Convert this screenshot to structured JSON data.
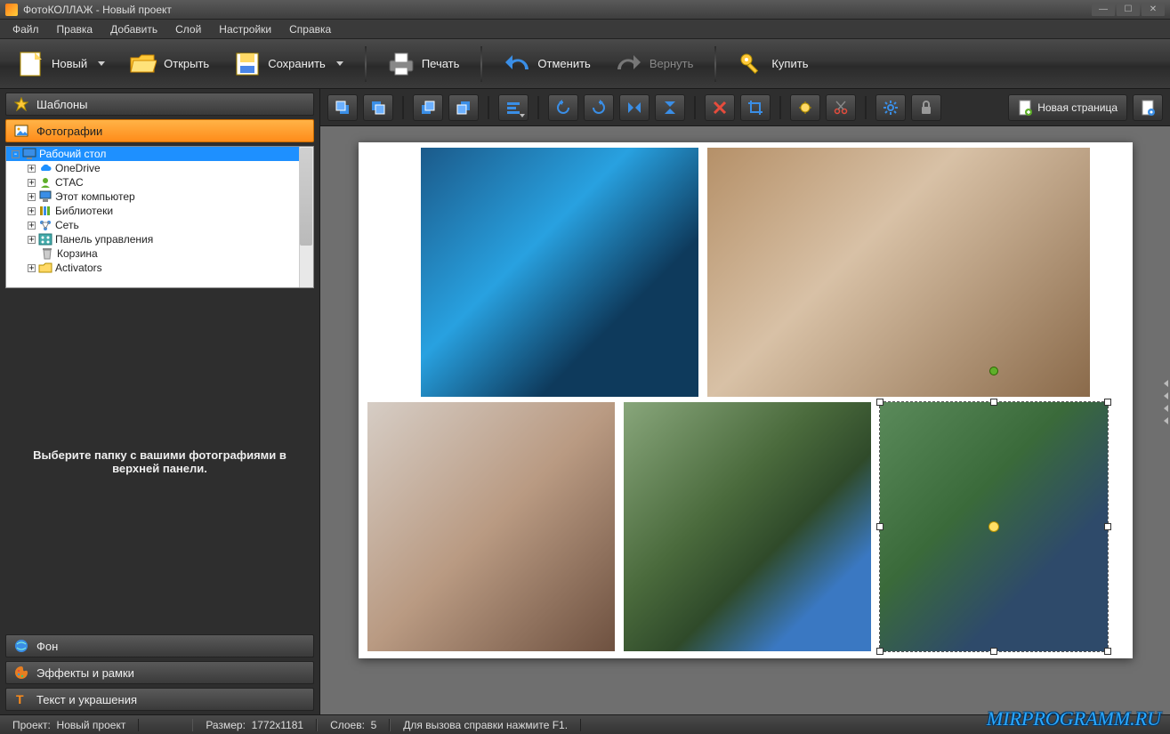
{
  "title": "ФотоКОЛЛАЖ - Новый проект",
  "menu": [
    "Файл",
    "Правка",
    "Добавить",
    "Слой",
    "Настройки",
    "Справка"
  ],
  "toolbar": {
    "new": "Новый",
    "open": "Открыть",
    "save": "Сохранить",
    "print": "Печать",
    "undo": "Отменить",
    "redo": "Вернуть",
    "buy": "Купить"
  },
  "sidebar": {
    "templates": "Шаблоны",
    "photos": "Фотографии",
    "background": "Фон",
    "effects": "Эффекты и рамки",
    "text": "Текст и украшения",
    "tree": [
      {
        "label": "Рабочий стол",
        "level": 0,
        "exp": "-",
        "icon": "desktop",
        "sel": true
      },
      {
        "label": "OneDrive",
        "level": 1,
        "exp": "+",
        "icon": "cloud"
      },
      {
        "label": "СТАС",
        "level": 1,
        "exp": "+",
        "icon": "user"
      },
      {
        "label": "Этот компьютер",
        "level": 1,
        "exp": "+",
        "icon": "pc"
      },
      {
        "label": "Библиотеки",
        "level": 1,
        "exp": "+",
        "icon": "lib"
      },
      {
        "label": "Сеть",
        "level": 1,
        "exp": "+",
        "icon": "net"
      },
      {
        "label": "Панель управления",
        "level": 1,
        "exp": "+",
        "icon": "panel"
      },
      {
        "label": "Корзина",
        "level": 1,
        "exp": "",
        "icon": "trash"
      },
      {
        "label": "Activators",
        "level": 1,
        "exp": "+",
        "icon": "folder"
      }
    ],
    "hint": "Выберите папку с вашими фотографиями в верхней панели."
  },
  "iconbar": {
    "new_page": "Новая страница"
  },
  "status": {
    "project_label": "Проект:",
    "project_name": "Новый проект",
    "size_label": "Размер:",
    "size_value": "1772x1181",
    "layers_label": "Слоев:",
    "layers_value": "5",
    "help": "Для вызова справки нажмите F1."
  },
  "watermark": "MIRPROGRAMM.RU"
}
